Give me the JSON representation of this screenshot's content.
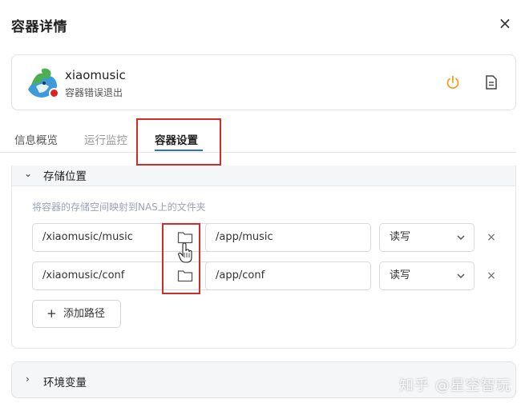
{
  "dialog": {
    "title": "容器详情",
    "close_icon": "×"
  },
  "app": {
    "name": "xiaomusic",
    "status": "容器错误退出",
    "status_color": "#e02020"
  },
  "tabs": [
    {
      "label": "信息概览",
      "active": false
    },
    {
      "label": "运行监控",
      "active": false
    },
    {
      "label": "容器设置",
      "active": true
    }
  ],
  "storage": {
    "title": "存储位置",
    "description": "将容器的存储空间映射到NAS上的文件夹",
    "mounts": [
      {
        "host_path": "/xiaomusic/music",
        "container_path": "/app/music",
        "mode": "读写"
      },
      {
        "host_path": "/xiaomusic/conf",
        "container_path": "/app/conf",
        "mode": "读写"
      }
    ],
    "add_button": "添加路径"
  },
  "env": {
    "title": "环境变量"
  },
  "watermark": "知乎 @星空智玩",
  "colors": {
    "accent": "#2a6fdb",
    "power": "#f0a020",
    "highlight": "#d12b2b",
    "error": "#e02020"
  },
  "icons": {
    "power": "power-icon",
    "doc": "document-icon",
    "folder": "folder-icon",
    "caret": "chevron-down-icon",
    "remove": "close-icon"
  }
}
